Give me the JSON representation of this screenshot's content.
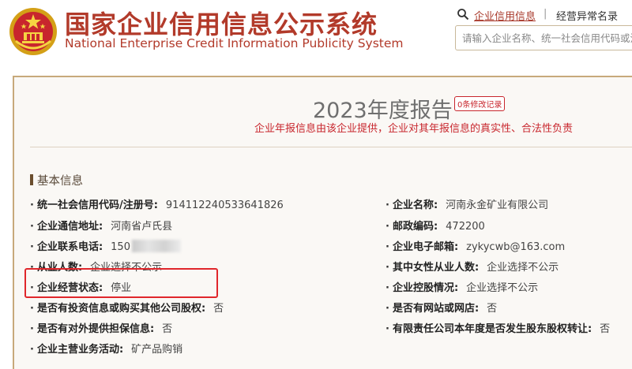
{
  "header": {
    "title_cn": "国家企业信用信息公示系统",
    "title_en": "National Enterprise Credit Information Publicity System",
    "nav_link_1": "企业信用信息",
    "nav_separator": "|",
    "nav_link_2": "经营异常名录",
    "search_placeholder": "请输入企业名称、统一社会信用代码或注册号"
  },
  "report": {
    "title": "2023年度报告",
    "modify_badge": "0条修改记录",
    "disclaimer": "企业年报信息由该企业提供，企业对其年报信息的真实性、合法性负责"
  },
  "basic_info": {
    "section_title": "基本信息",
    "fields": [
      {
        "label": "统一社会信用代码/注册号:",
        "value": "914112240533641826"
      },
      {
        "label": "企业名称:",
        "value": "河南永金矿业有限公司"
      },
      {
        "label": "企业通信地址:",
        "value": "河南省卢氏县"
      },
      {
        "label": "邮政编码:",
        "value": "472200"
      },
      {
        "label": "企业联系电话:",
        "value": "150"
      },
      {
        "label": "企业电子邮箱:",
        "value": "zykycwb@163.com"
      },
      {
        "label": "从业人数:",
        "value": "企业选择不公示"
      },
      {
        "label": "其中女性从业人数:",
        "value": "企业选择不公示"
      },
      {
        "label": "企业经营状态:",
        "value": "停业"
      },
      {
        "label": "企业控股情况:",
        "value": "企业选择不公示"
      },
      {
        "label": "是否有投资信息或购买其他公司股权:",
        "value": "否"
      },
      {
        "label": "是否有网站或网店:",
        "value": "否"
      },
      {
        "label": "是否有对外提供担保信息:",
        "value": "否"
      },
      {
        "label": "有限责任公司本年度是否发生股东股权转让:",
        "value": "否"
      },
      {
        "label": "企业主营业务活动:",
        "value": "矿产品购销"
      }
    ]
  },
  "colors": {
    "brand_red": "#b23a2a",
    "warning_red": "#c8262d",
    "highlight_box": "#e0262b",
    "panel_border": "#c7a97b"
  }
}
